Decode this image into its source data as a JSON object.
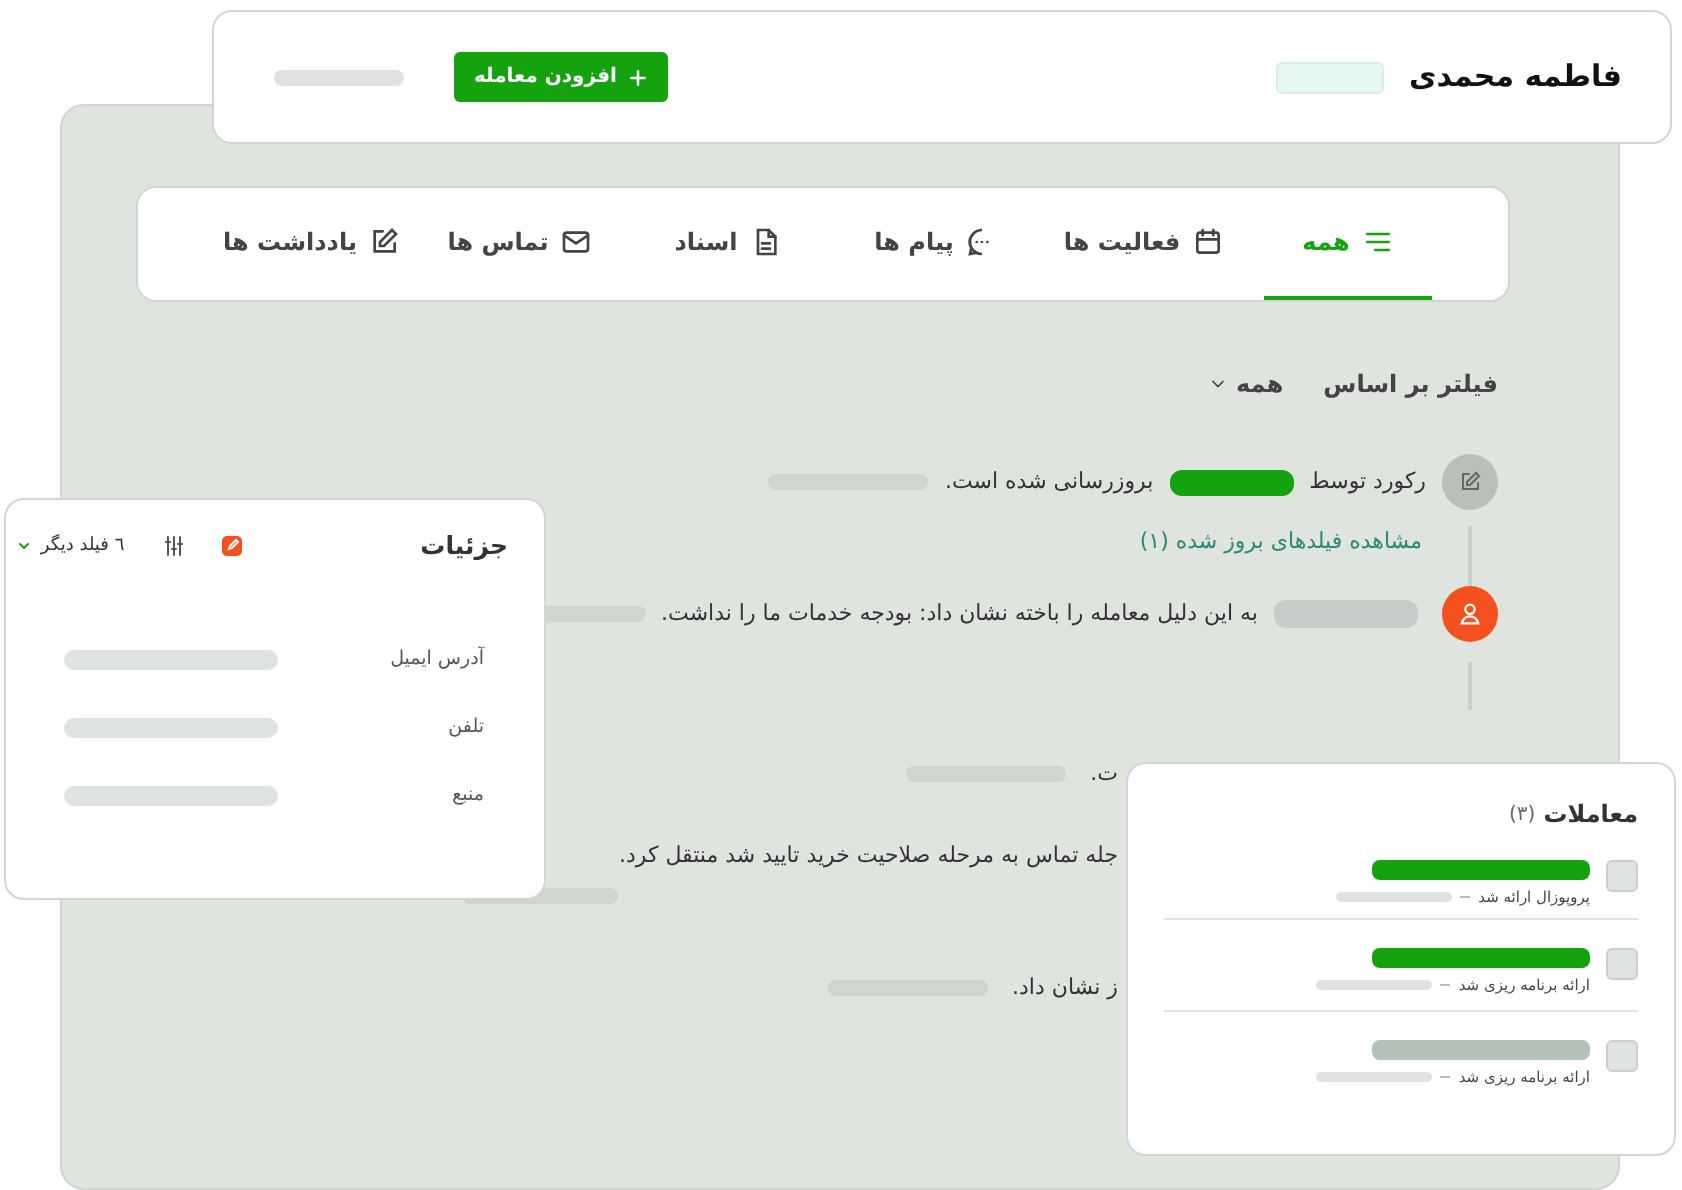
{
  "header": {
    "name": "فاطمه محمدی",
    "add_button": "افزودن معامله"
  },
  "tabs": [
    {
      "label": "همه",
      "kind": "lines",
      "selected": true
    },
    {
      "label": "فعالیت ها",
      "kind": "calendar",
      "selected": false
    },
    {
      "label": "پیام ها",
      "kind": "chat",
      "selected": false
    },
    {
      "label": "اسناد",
      "kind": "document",
      "selected": false
    },
    {
      "label": "تماس ها",
      "kind": "mail",
      "selected": false
    },
    {
      "label": "یادداشت ها",
      "kind": "note",
      "selected": false
    }
  ],
  "filter": {
    "label": "فیلتر بر اساس",
    "value": "همه"
  },
  "timeline": [
    {
      "kind": "update",
      "before": "رکورد توسط",
      "after": "بروزرسانی شده است.",
      "link": "مشاهده فیلدهای بروز شده (۱)"
    },
    {
      "kind": "user",
      "text": "به این دلیل معامله را باخته نشان داد: بودجه خدمات ما را نداشت."
    },
    {
      "kind": "partial",
      "text": "ت."
    },
    {
      "kind": "partial",
      "text": "جله تماس به مرحله صلاحیت خرید تایید شد منتقل کرد."
    },
    {
      "kind": "partial",
      "text": "ز نشان داد."
    }
  ],
  "details": {
    "title": "جزئیات",
    "more": "٦ فیلد دیگر",
    "fields": [
      "آدرس ایمیل",
      "تلفن",
      "منبع"
    ]
  },
  "deals": {
    "title": "معاملات",
    "count": "(۳)",
    "items": [
      {
        "stage": "پروپوزال ارائه شد",
        "color": "#13a10e",
        "checked": false
      },
      {
        "stage": "ارائه برنامه ریزی شد",
        "color": "#13a10e",
        "checked": false
      },
      {
        "stage": "ارائه برنامه ریزی شد",
        "color": "#b3c2b6",
        "checked": false
      }
    ]
  }
}
